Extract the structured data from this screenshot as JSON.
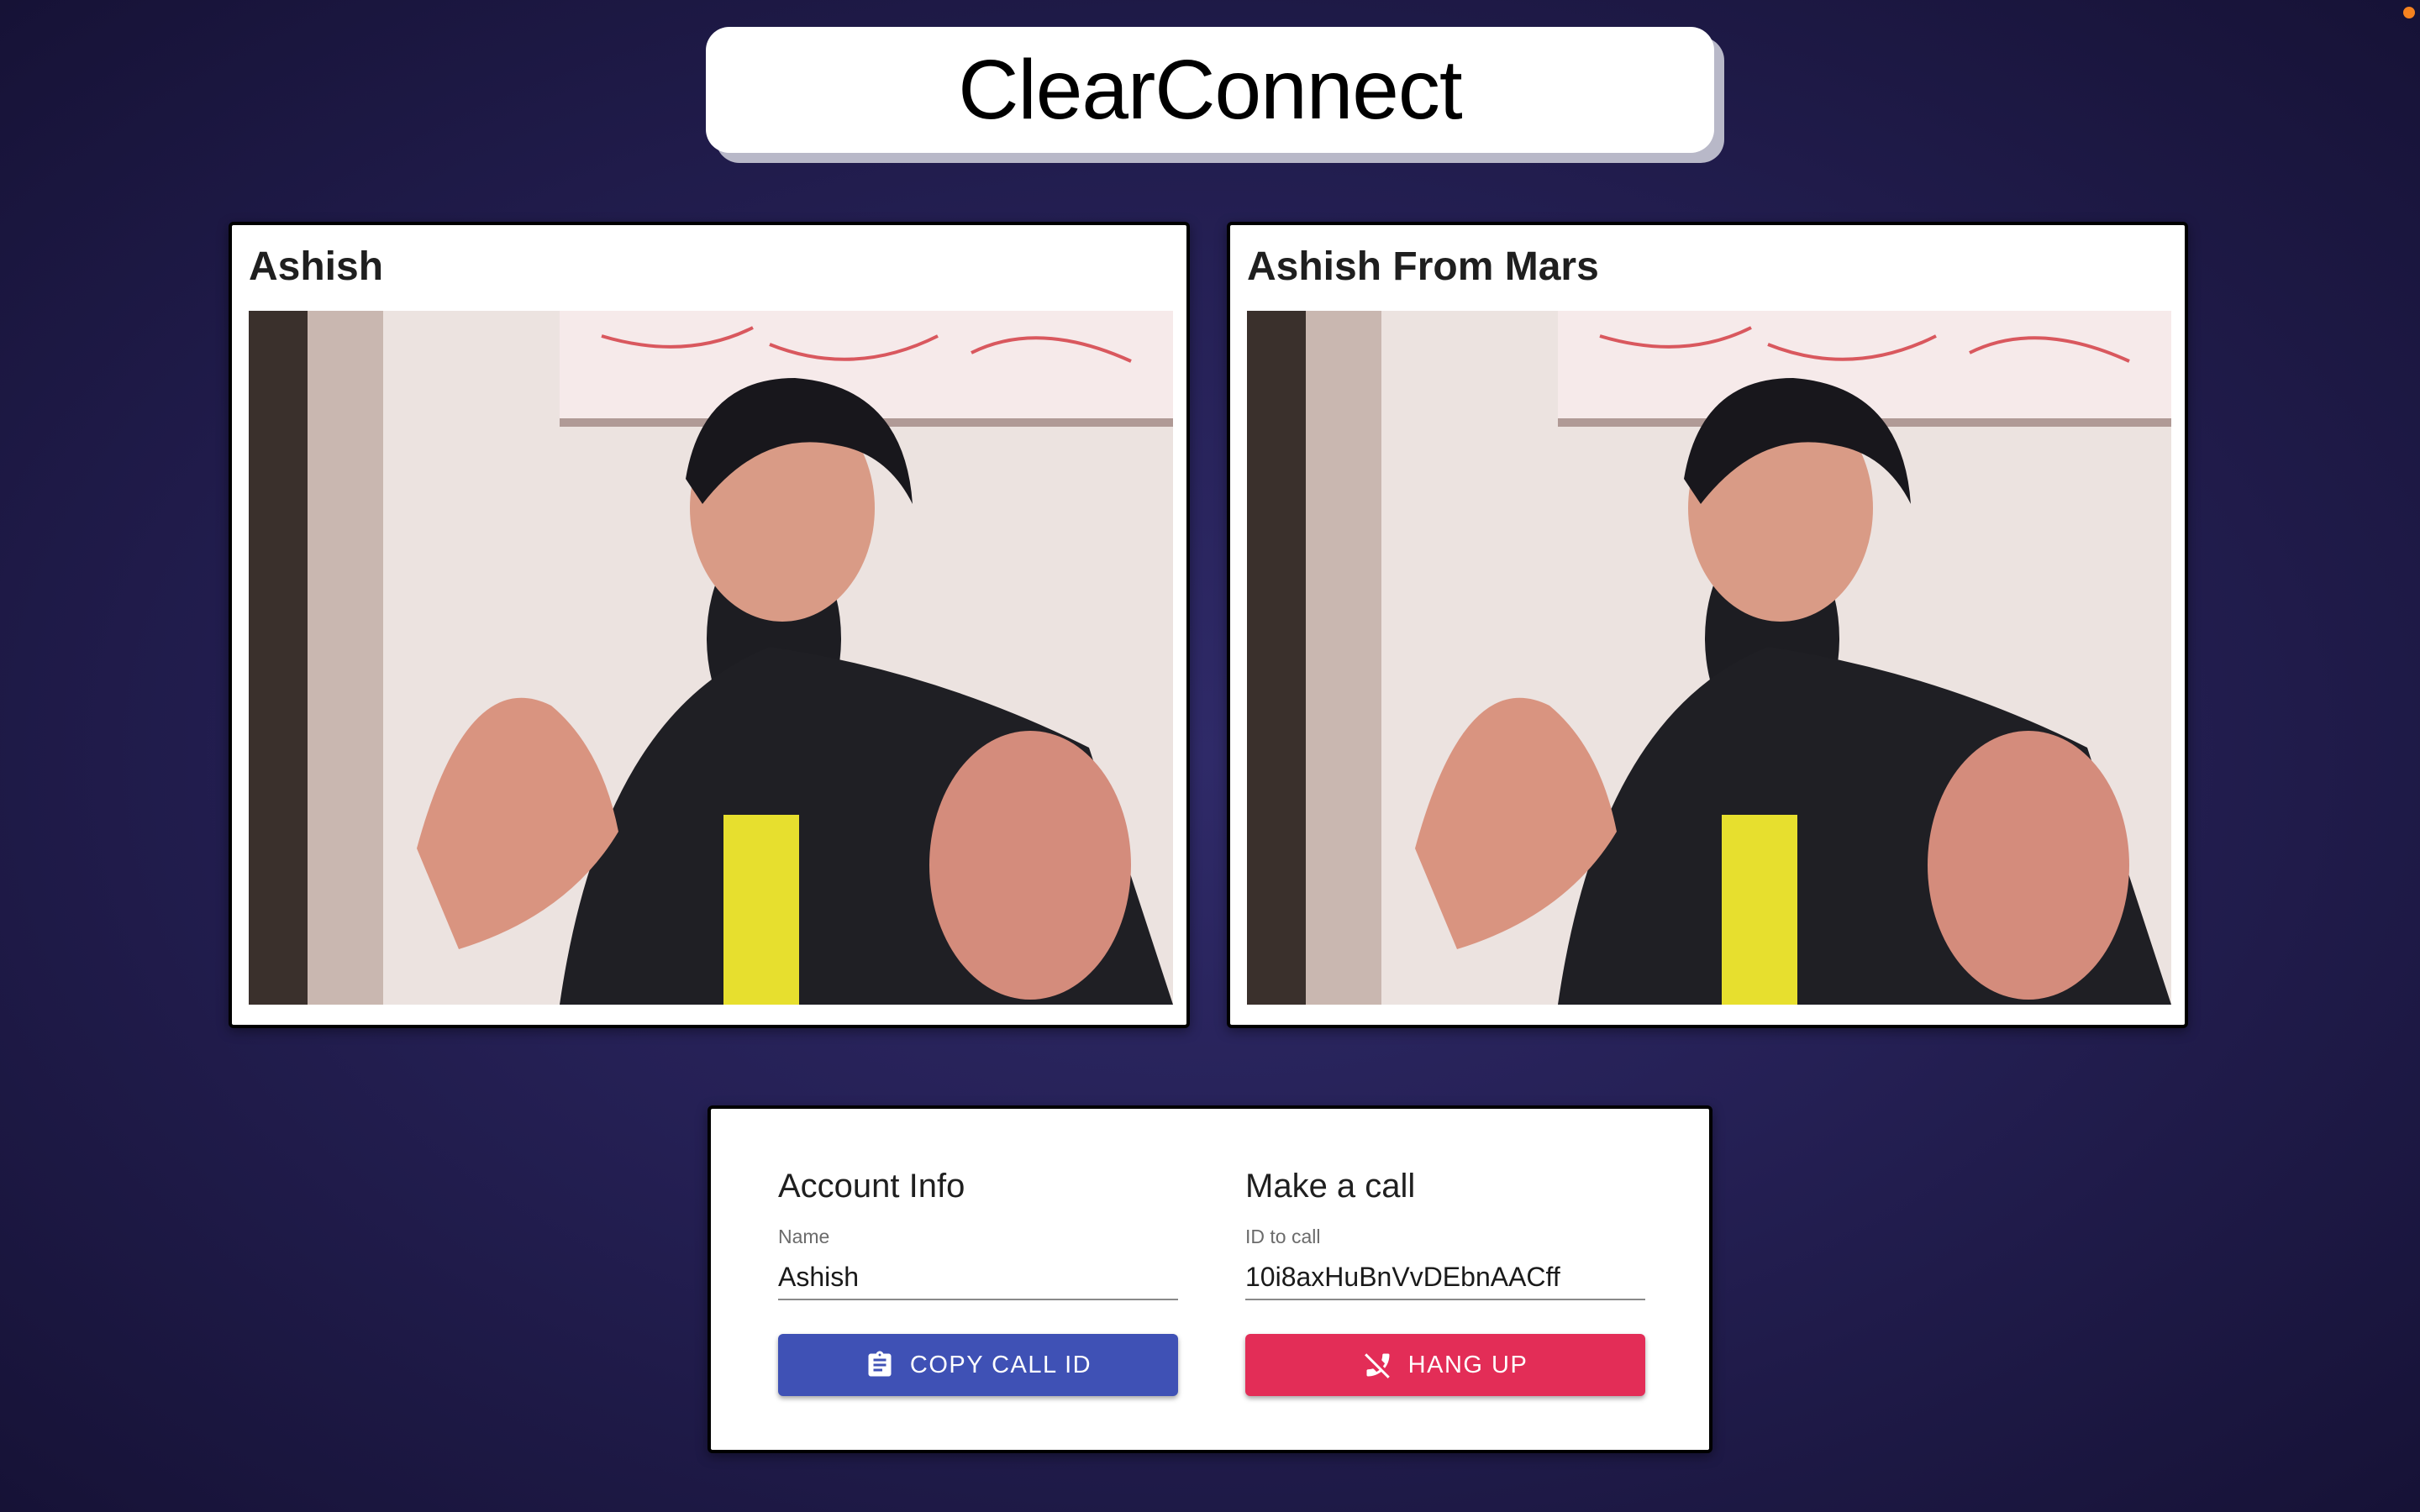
{
  "app": {
    "title": "ClearConnect"
  },
  "videos": {
    "local": {
      "name": "Ashish"
    },
    "remote": {
      "name": "Ashish From Mars"
    }
  },
  "account": {
    "heading": "Account Info",
    "name_label": "Name",
    "name_value": "Ashish",
    "copy_button_label": "COPY CALL ID",
    "copy_icon": "clipboard-icon"
  },
  "call": {
    "heading": "Make a call",
    "id_label": "ID to call",
    "id_value": "10i8axHuBnVvDEbnAACff",
    "hangup_button_label": "HANG UP",
    "hangup_icon": "phone-disabled-icon"
  },
  "colors": {
    "copy_button": "#3f51b5",
    "hangup_button": "#e32d57",
    "status_dot": "#f5821f"
  }
}
